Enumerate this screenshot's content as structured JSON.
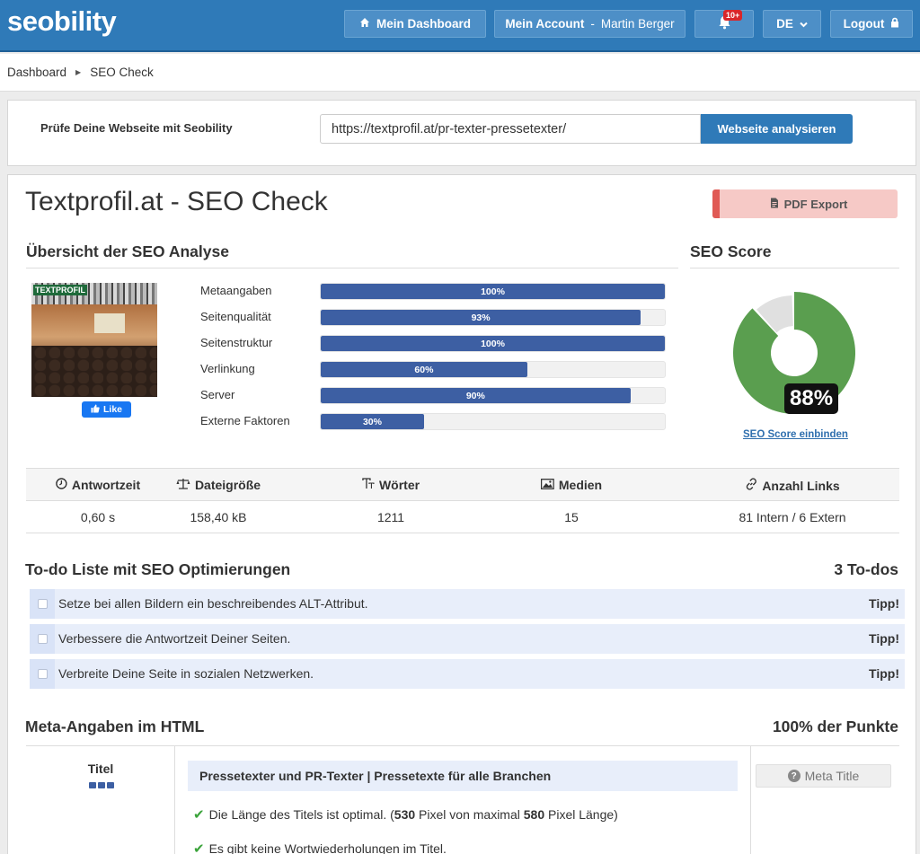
{
  "header": {
    "logo": "seobility",
    "dashboard_label": "Mein Dashboard",
    "account_label": "Mein Account",
    "account_user": "Martin Berger",
    "notifications_badge": "10+",
    "language": "DE",
    "logout_label": "Logout"
  },
  "breadcrumb": {
    "items": [
      "Dashboard",
      "SEO Check"
    ]
  },
  "analyze": {
    "label": "Prüfe Deine Webseite mit Seobility",
    "url_value": "https://textprofil.at/pr-texter-pressetexter/",
    "button_label": "Webseite analysieren"
  },
  "main": {
    "title": "Textprofil.at - SEO Check",
    "pdf_label": "PDF Export",
    "overview_heading": "Übersicht der SEO Analyse",
    "score_heading": "SEO Score",
    "thumbnail_logo": "TEXTPROFIL",
    "like_label": "Like",
    "bars": [
      {
        "label": "Metaangaben",
        "value": 100,
        "text": "100%"
      },
      {
        "label": "Seitenqualität",
        "value": 93,
        "text": "93%"
      },
      {
        "label": "Seitenstruktur",
        "value": 100,
        "text": "100%"
      },
      {
        "label": "Verlinkung",
        "value": 60,
        "text": "60%"
      },
      {
        "label": "Server",
        "value": 90,
        "text": "90%"
      },
      {
        "label": "Externe Faktoren",
        "value": 30,
        "text": "30%"
      }
    ],
    "seo_score": {
      "value": 88,
      "text": "88%",
      "link": "SEO Score einbinden",
      "color_good": "#5a9e4f",
      "color_rest": "#e0e0e0"
    },
    "stats": [
      {
        "label": "Antwortzeit",
        "value": "0,60 s",
        "icon": "clock-icon"
      },
      {
        "label": "Dateigröße",
        "value": "158,40 kB",
        "icon": "scale-icon"
      },
      {
        "label": "Wörter",
        "value": "1211",
        "icon": "text-icon"
      },
      {
        "label": "Medien",
        "value": "15",
        "icon": "image-icon"
      },
      {
        "label": "Anzahl Links",
        "value": "81 Intern / 6 Extern",
        "icon": "link-icon"
      }
    ],
    "todo_heading": "To-do Liste mit SEO Optimierungen",
    "todo_count": "3 To-dos",
    "todos": [
      {
        "text": "Setze bei allen Bildern ein beschreibendes ALT-Attribut.",
        "tag": "Tipp!"
      },
      {
        "text": "Verbessere die Antwortzeit Deiner Seiten.",
        "tag": "Tipp!"
      },
      {
        "text": "Verbreite Deine Seite in sozialen Netzwerken.",
        "tag": "Tipp!"
      }
    ],
    "meta_heading": "Meta-Angaben im HTML",
    "meta_points": "100% der Punkte",
    "meta": {
      "item_label": "Titel",
      "title_value": "Pressetexter und PR-Texter | Pressetexte für alle Branchen",
      "check1_a": "Die Länge des Titels ist optimal. (",
      "check1_b": "530",
      "check1_c": " Pixel von maximal ",
      "check1_d": "580",
      "check1_e": " Pixel Länge)",
      "check2": "Es gibt keine Wortwiederholungen im Titel.",
      "tag_label": "Meta Title"
    }
  },
  "colors": {
    "brand": "#2f7ab8",
    "bar": "#3d5fa3",
    "score": "#5a9e4f"
  }
}
